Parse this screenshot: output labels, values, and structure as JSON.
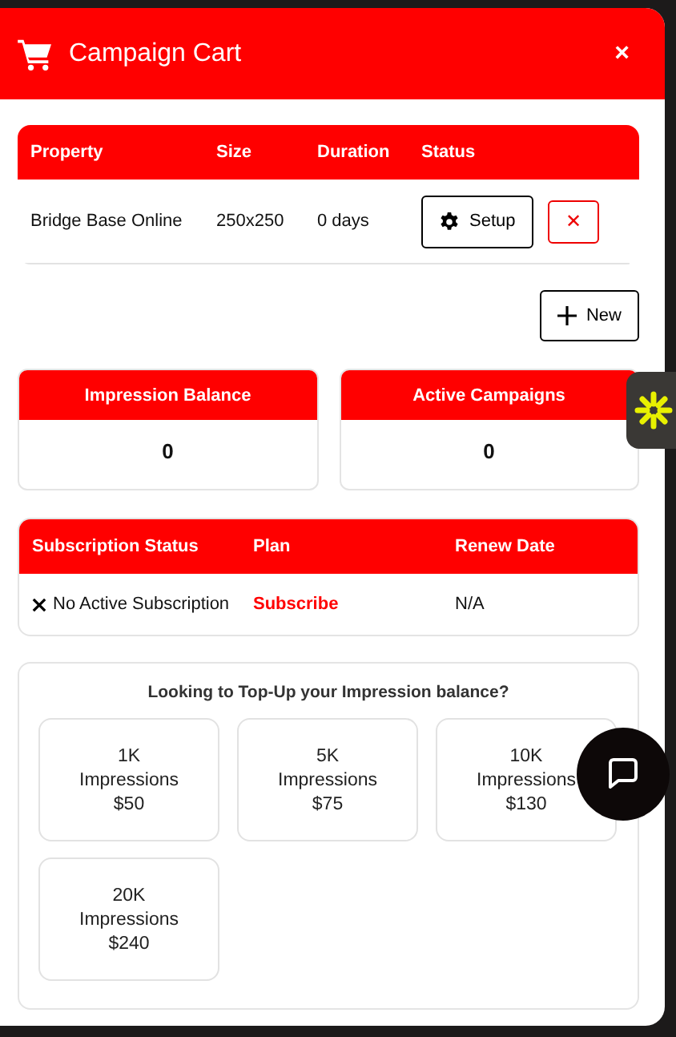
{
  "window": {
    "title": "Campaign Cart",
    "close": "×"
  },
  "cart": {
    "columns": [
      "Property",
      "Size",
      "Duration",
      "Status"
    ],
    "rows": [
      {
        "property": "Bridge Base Online",
        "size": "250x250",
        "duration": "0 days",
        "setup": "Setup",
        "remove": "✕"
      }
    ]
  },
  "new_button": "New",
  "stats": [
    {
      "title": "Impression Balance",
      "value": "0"
    },
    {
      "title": "Active Campaigns",
      "value": "0"
    }
  ],
  "subscription": {
    "columns": [
      "Subscription Status",
      "Plan",
      "Renew Date"
    ],
    "rows": [
      {
        "status": "No Active Subscription",
        "plan": "Subscribe",
        "renew": "N/A"
      }
    ]
  },
  "topup": {
    "prompt": "Looking to Top-Up your Impression balance?",
    "options": [
      {
        "amount": "1K",
        "unit": "Impressions",
        "price": "$50"
      },
      {
        "amount": "5K",
        "unit": "Impressions",
        "price": "$75"
      },
      {
        "amount": "10K",
        "unit": "Impressions",
        "price": "$130"
      },
      {
        "amount": "20K",
        "unit": "Impressions",
        "price": "$240"
      }
    ]
  }
}
